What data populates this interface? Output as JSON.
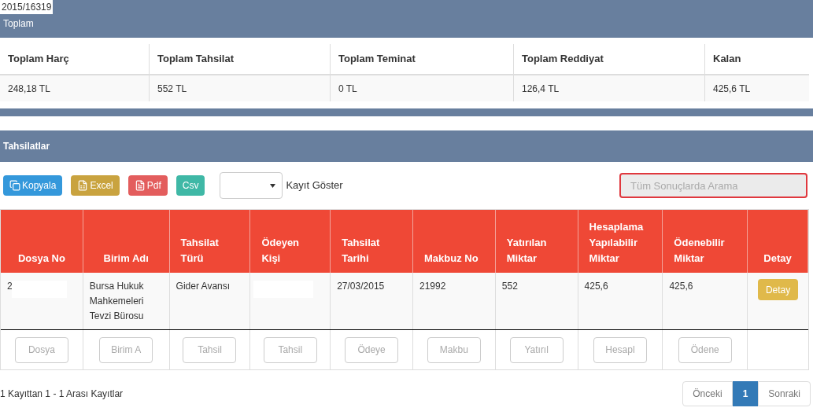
{
  "overlay_label": "2015/16319",
  "summary": {
    "title": "Toplam",
    "columns": [
      "Toplam Harç",
      "Toplam Tahsilat",
      "Toplam Teminat",
      "Toplam Reddiyat",
      "Kalan"
    ],
    "values": [
      "248,18 TL",
      "552 TL",
      "0 TL",
      "126,4 TL",
      "425,6 TL"
    ]
  },
  "section": {
    "title": "Tahsilatlar"
  },
  "toolbar": {
    "buttons": [
      {
        "kind": "copy",
        "label": "Kopyala"
      },
      {
        "kind": "excel",
        "label": "Excel"
      },
      {
        "kind": "pdf",
        "label": "Pdf"
      },
      {
        "kind": "csv",
        "label": "Csv"
      }
    ],
    "page_size_label": "Kayıt Göster",
    "search": {
      "placeholder": "Tüm Sonuçlarda Arama"
    }
  },
  "table": {
    "columns": [
      "Dosya No",
      "Birim Adı",
      "Tahsilat Türü",
      "Ödeyen Kişi",
      "Tahsilat Tarihi",
      "Makbuz No",
      "Yatırılan Miktar",
      "Hesaplama Yapılabilir Miktar",
      "Ödenebilir Miktar",
      "Detay"
    ],
    "rows": [
      {
        "cells": [
          {
            "text": "2",
            "redacted": true
          },
          {
            "text": "Bursa Hukuk Mahkemeleri Tevzi Bürosu",
            "redacted": false
          },
          {
            "text": "Gider Avansı",
            "redacted": false
          },
          {
            "redacted": true
          },
          {
            "text": "27/03/2015",
            "redacted": false
          },
          {
            "text": "21992",
            "redacted": false
          },
          {
            "text": "552",
            "redacted": false
          },
          {
            "text": "425,6",
            "redacted": false
          },
          {
            "text": "425,6",
            "redacted": false
          }
        ],
        "action": "Detay"
      }
    ],
    "filters": [
      {
        "placeholder": "Dosya"
      },
      {
        "placeholder": "Birim A"
      },
      {
        "placeholder": "Tahsil"
      },
      {
        "placeholder": "Tahsil"
      },
      {
        "placeholder": "Ödeye"
      },
      {
        "placeholder": "Makbu"
      },
      {
        "placeholder": "Yatırıl"
      },
      {
        "placeholder": "Hesapl"
      },
      {
        "placeholder": "Ödene"
      }
    ]
  },
  "footer": {
    "info": "1 Kayıttan 1 - 1 Arası Kayıtlar",
    "pagination": [
      {
        "label": "Önceki",
        "selected": false
      },
      {
        "label": "1",
        "selected": true
      },
      {
        "label": "Sonraki",
        "selected": false
      }
    ]
  }
}
